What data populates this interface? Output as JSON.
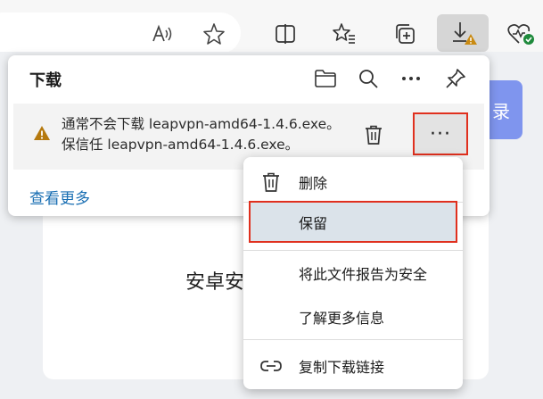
{
  "toolbar": {
    "icons": [
      "read-aloud-icon",
      "favorite-star-icon",
      "split-screen-icon",
      "favorites-list-icon",
      "collections-icon",
      "downloads-warning-icon",
      "browser-essentials-icon"
    ]
  },
  "page": {
    "card_text": "安卓安",
    "button_text": "录"
  },
  "downloads": {
    "title": "下载",
    "item": {
      "line1": "通常不会下载 leapvpn-amd64-1.4.6.exe。",
      "line2": "保信任 leapvpn-amd64-1.4.6.exe。",
      "more_label": "···"
    },
    "see_more": "查看更多"
  },
  "context_menu": {
    "items": [
      {
        "label": "删除",
        "icon": "trash-icon"
      },
      {
        "label": "保留",
        "icon": ""
      },
      {
        "label": "将此文件报告为安全",
        "icon": ""
      },
      {
        "label": "了解更多信息",
        "icon": ""
      },
      {
        "label": "复制下载链接",
        "icon": "link-icon"
      }
    ]
  },
  "colors": {
    "highlight_border": "#e0301e",
    "link": "#1a6fb3",
    "warning": "#b5790e"
  }
}
